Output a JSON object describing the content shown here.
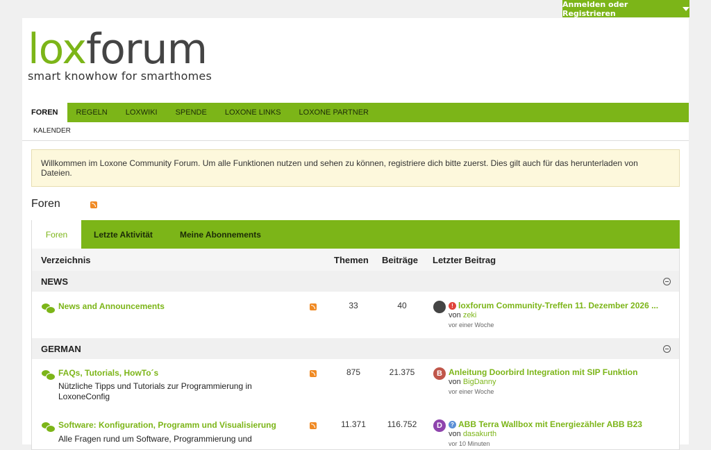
{
  "topbar": {
    "login_label": "Anmelden oder Registrieren"
  },
  "logo": {
    "part1": "lox",
    "part2": "forum",
    "tagline": "smart knowhow for smarthomes"
  },
  "nav": {
    "items": [
      "FOREN",
      "REGELN",
      "LOXWIKI",
      "SPENDE",
      "LOXONE LINKS",
      "LOXONE PARTNER"
    ],
    "sub_items": [
      "KALENDER"
    ]
  },
  "notice": "Willkommen im Loxone Community Forum. Um alle Funktionen nutzen und sehen zu können, registriere dich bitte zuerst. Dies gilt auch für das herunterladen von Dateien.",
  "section_title": "Foren",
  "tabs": [
    "Foren",
    "Letzte Aktivität",
    "Meine Abonnements"
  ],
  "table_headers": {
    "directory": "Verzeichnis",
    "topics": "Themen",
    "posts": "Beiträge",
    "last_post": "Letzter Beitrag"
  },
  "categories": [
    {
      "name": "NEWS",
      "forums": [
        {
          "name": "News and Announcements",
          "desc": "",
          "topics": "33",
          "posts": "40",
          "last_title": "loxforum Community-Treffen 11. Dezember 2026 ...",
          "last_by_prefix": "von",
          "last_user": "zeki",
          "last_time": "vor einer Woche"
        }
      ]
    },
    {
      "name": "GERMAN",
      "forums": [
        {
          "name": "FAQs, Tutorials, HowTo´s",
          "desc": "Nützliche Tipps und Tutorials zur Programmierung in LoxoneConfig",
          "topics": "875",
          "posts": "21.375",
          "last_title": "Anleitung Doorbird Integration mit SIP Funktion",
          "last_by_prefix": "von",
          "last_user": "BigDanny",
          "last_time": "vor einer Woche",
          "avatar_letter": "B"
        },
        {
          "name": "Software: Konfiguration, Programm und Visualisierung",
          "desc": "Alle Fragen rund um Software, Programmierung und",
          "topics": "11.371",
          "posts": "116.752",
          "last_title": "ABB Terra Wallbox mit Energiezähler ABB B23",
          "last_by_prefix": "von",
          "last_user": "dasakurth",
          "last_time": "vor 10 Minuten",
          "avatar_letter": "D"
        }
      ]
    }
  ],
  "colors": {
    "accent": "#7cb518",
    "notice_bg": "#fdf8dc",
    "rss": "#f08a24",
    "avatar_b": "#c0564a",
    "avatar_d": "#8e44ad"
  }
}
